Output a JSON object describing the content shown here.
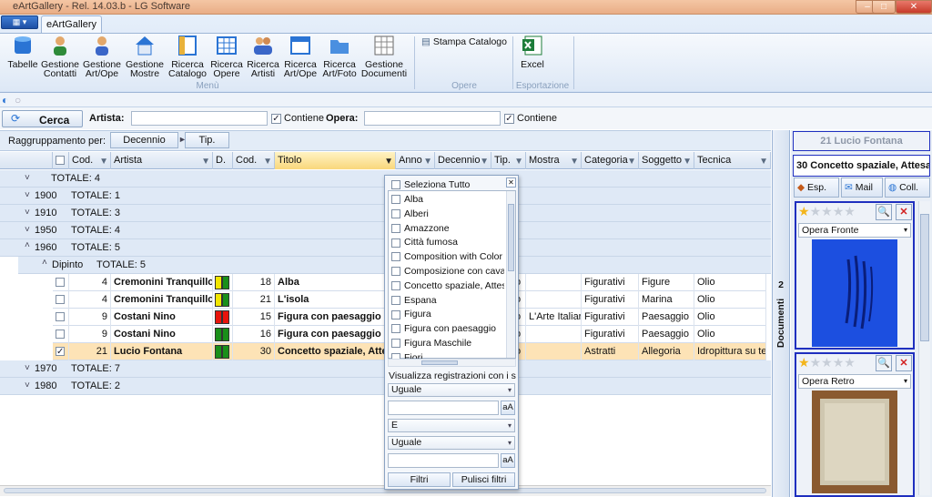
{
  "window": {
    "title": "eArtGallery - Rel. 14.03.b - LG Software",
    "controls": [
      "–",
      "□",
      "✕"
    ]
  },
  "ribbon": {
    "app_button": "▾",
    "tab": "eArtGallery",
    "buttons": [
      "Tabelle",
      "Gestione Contatti",
      "Gestione Art/Ope",
      "Gestione Mostre",
      "Ricerca Catalogo",
      "Ricerca Opere",
      "Ricerca Artisti",
      "Ricerca Art/Ope",
      "Ricerca Art/Foto",
      "Gestione Documenti"
    ],
    "stampa": "Stampa Catalogo",
    "excel": "Excel",
    "groups": {
      "menu": "Menù",
      "opere": "Opere",
      "export": "Esportazione"
    }
  },
  "search": {
    "cerca": "Cerca",
    "artista_label": "Artista:",
    "artista_value": "",
    "contiene1": "Contiene",
    "opera_label": "Opera:",
    "opera_value": "",
    "contiene2": "Contiene"
  },
  "grouping": {
    "label": "Raggruppamento per:",
    "chips": [
      "Decennio",
      "Tip."
    ]
  },
  "headers": [
    "Cod.",
    "Artista",
    "D.",
    "Cod.",
    "Titolo",
    "Anno",
    "Decennio",
    "Tip.",
    "Mostra",
    "Categoria",
    "Soggetto",
    "Tecnica"
  ],
  "groups": [
    {
      "label": "TOTALE: 4"
    },
    {
      "label": "1900",
      "total": "TOTALE: 1"
    },
    {
      "label": "1910",
      "total": "TOTALE: 3"
    },
    {
      "label": "1950",
      "total": "TOTALE: 4"
    },
    {
      "label": "1960",
      "total": "TOTALE: 5"
    }
  ],
  "subgroup": {
    "label": "Dipinto",
    "total": "TOTALE: 5"
  },
  "rows": [
    {
      "cod": "4",
      "artista": "Cremonini Tranquillo",
      "cod2": "18",
      "titolo": "Alba",
      "tip": "o",
      "mostra": "",
      "categoria": "Figurativi",
      "soggetto": "Figure",
      "tecnica": "Olio",
      "colors": [
        "#f2e600",
        "#1a8f1a"
      ]
    },
    {
      "cod": "4",
      "artista": "Cremonini Tranquillo",
      "cod2": "21",
      "titolo": "L'isola",
      "tip": "o",
      "mostra": "",
      "categoria": "Figurativi",
      "soggetto": "Marina",
      "tecnica": "Olio",
      "colors": [
        "#f2e600",
        "#1a8f1a"
      ]
    },
    {
      "cod": "9",
      "artista": "Costani Nino",
      "cod2": "15",
      "titolo": "Figura con paesaggio",
      "tip": "o",
      "mostra": "L'Arte Italiar",
      "categoria": "Figurativi",
      "soggetto": "Paesaggio",
      "tecnica": "Olio",
      "colors": [
        "#e8140c",
        "#e8140c"
      ]
    },
    {
      "cod": "9",
      "artista": "Costani Nino",
      "cod2": "16",
      "titolo": "Figura con paesaggio",
      "tip": "o",
      "mostra": "",
      "categoria": "Figurativi",
      "soggetto": "Paesaggio",
      "tecnica": "Olio",
      "colors": [
        "#1a8f1a",
        "#1a8f1a"
      ]
    },
    {
      "cod": "21",
      "artista": "Lucio Fontana",
      "cod2": "30",
      "titolo": "Concetto spaziale, Atte",
      "tip": "o",
      "mostra": "",
      "categoria": "Astratti",
      "soggetto": "Allegoria",
      "tecnica": "Idropittura su tela",
      "colors": [
        "#1a8f1a",
        "#1a8f1a"
      ],
      "selected": true
    }
  ],
  "groups_after": [
    {
      "label": "1970",
      "total": "TOTALE: 7"
    },
    {
      "label": "1980",
      "total": "TOTALE: 2"
    }
  ],
  "filter_popup": {
    "select_all": "Seleziona Tutto",
    "items": [
      "Alba",
      "Alberi",
      "Amazzone",
      "Città fumosa",
      "Composition with Color I",
      "Composizione con cavall",
      "Concetto spaziale, Attes",
      "Espana",
      "Figura",
      "Figura con paesaggio",
      "Figura Maschile",
      "Fiori"
    ],
    "caption": "Visualizza registrazioni con i se",
    "op1": "Uguale",
    "val1": "",
    "case_btn": "aA",
    "logic": "E",
    "op2": "Uguale",
    "val2": "",
    "filtri": "Filtri",
    "pulisci": "Pulisci filtri"
  },
  "documents": {
    "count": "2",
    "label": "Documenti"
  },
  "right": {
    "artist": "21 Lucio Fontana",
    "work": "30 Concetto spaziale, Attesa",
    "btn_esp": "Esp.",
    "btn_mail": "Mail",
    "btn_coll": "Coll.",
    "card1_select": "Opera Fronte",
    "card2_select": "Opera Retro",
    "card1_stars": 1,
    "card2_stars": 1
  }
}
